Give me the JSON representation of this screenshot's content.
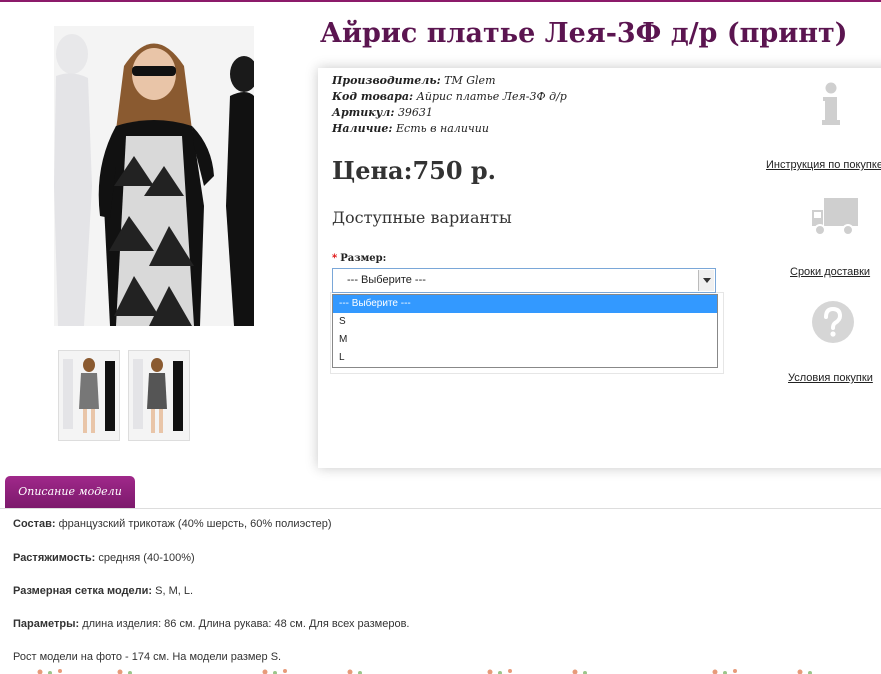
{
  "product": {
    "title": "Айрис платье Лея-3Ф д/р (принт)",
    "info": [
      {
        "key": "Производитель:",
        "value": "TM Glem"
      },
      {
        "key": "Код товара:",
        "value": "Айрис платье Лея-3Ф д/р"
      },
      {
        "key": "Артикул:",
        "value": "39631"
      },
      {
        "key": "Наличие:",
        "value": "Есть в наличии"
      }
    ],
    "price": "Цена:750 р.",
    "variants_heading": "Доступные варианты",
    "size_label": "Размер:",
    "required_mark": "*",
    "select_value": "--- Выберите ---",
    "options": [
      "--- Выберите ---",
      "S",
      "M",
      "L"
    ]
  },
  "side": {
    "instruction": "Инструкция по покупке",
    "delivery": "Сроки доставки",
    "conditions": "Условия покупки"
  },
  "tab": {
    "label": "Описание модели"
  },
  "description": [
    {
      "key": "Состав:",
      "value": " французский трикотаж (40% шерсть, 60% полиэстер)"
    },
    {
      "key": "Растяжимость:",
      "value": " средняя (40-100%)"
    },
    {
      "key": "Размерная сетка модели:",
      "value": " S, M, L."
    },
    {
      "key": "Параметры:",
      "value": " длина изделия: 86 см. Длина рукава: 48 см. Для всех размеров."
    },
    {
      "key": "",
      "value": "Рост модели на фото - 174 см. На модели размер S."
    }
  ],
  "colors": {
    "title": "#5b1550",
    "tab": "#8c1a6a",
    "selected_option": "#3399ff"
  }
}
